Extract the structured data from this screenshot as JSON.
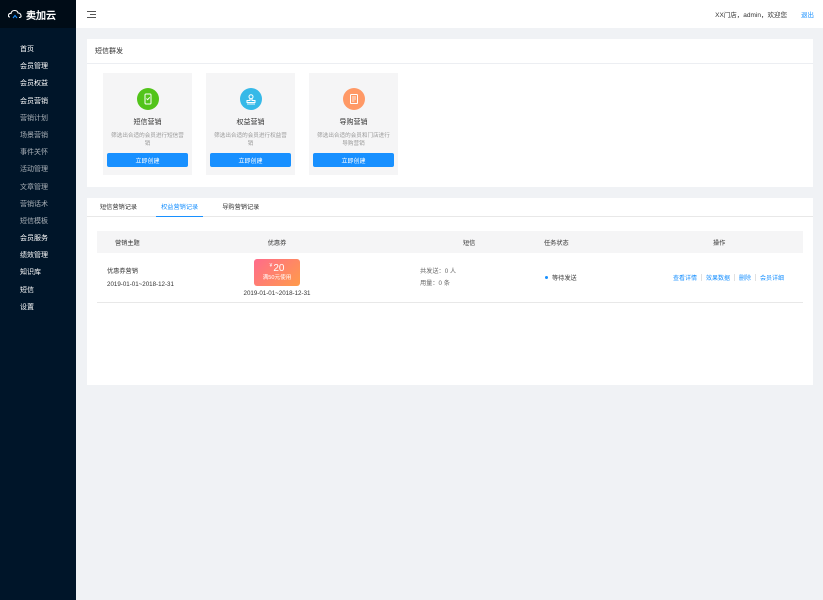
{
  "app": {
    "title": "卖加云"
  },
  "sidebar": {
    "items": [
      {
        "label": "首页",
        "type": "main"
      },
      {
        "label": "会员管理",
        "type": "main"
      },
      {
        "label": "会员权益",
        "type": "main"
      },
      {
        "label": "会员营销",
        "type": "main"
      },
      {
        "label": "营销计划",
        "type": "sub"
      },
      {
        "label": "场景营销",
        "type": "sub"
      },
      {
        "label": "事件关怀",
        "type": "sub"
      },
      {
        "label": "活动管理",
        "type": "sub"
      },
      {
        "label": "文章管理",
        "type": "sub"
      },
      {
        "label": "营销话术",
        "type": "sub"
      },
      {
        "label": "短信模板",
        "type": "sub"
      },
      {
        "label": "会员服务",
        "type": "main"
      },
      {
        "label": "绩效管理",
        "type": "main"
      },
      {
        "label": "知识库",
        "type": "main"
      },
      {
        "label": "短信",
        "type": "main"
      },
      {
        "label": "设置",
        "type": "main"
      }
    ]
  },
  "header": {
    "user_info": "XX门店，admin，欢迎您",
    "logout_label": "退出"
  },
  "section": {
    "title": "短信群发"
  },
  "cards": [
    {
      "title": "短信营销",
      "desc": "筛选出合适的会员进行短信营销",
      "button": "立即创建",
      "color": "#52c41a",
      "icon": "phone-icon"
    },
    {
      "title": "权益营销",
      "desc": "筛选出合适的会员进行权益营销",
      "button": "立即创建",
      "color": "#36b9e8",
      "icon": "stamp-icon"
    },
    {
      "title": "导购营销",
      "desc": "筛选出合适的会员和门店进行导购营销",
      "button": "立即创建",
      "color": "#ff9966",
      "icon": "document-icon"
    }
  ],
  "tabs": [
    {
      "label": "短信营销记录",
      "active": false
    },
    {
      "label": "权益营销记录",
      "active": true
    },
    {
      "label": "导购营销记录",
      "active": false
    }
  ],
  "table": {
    "headers": [
      "营销主题",
      "优惠券",
      "短信",
      "任务状态",
      "操作"
    ],
    "rows": [
      {
        "title": "优惠券营销",
        "date": "2019-01-01~2018-12-31",
        "coupon": {
          "yen": "¥",
          "amount": "20",
          "condition": "满50元使用",
          "date": "2019-01-01~2018-12-31"
        },
        "sms_sent": "共发送：0 人",
        "sms_used": "用量：0 条",
        "status": "等待发送",
        "status_color": "#1890ff",
        "ops": [
          "查看详情",
          "效果数据",
          "删除",
          "会员详细"
        ]
      }
    ]
  },
  "colors": {
    "primary": "#1890ff",
    "sidebar": "#001529"
  }
}
